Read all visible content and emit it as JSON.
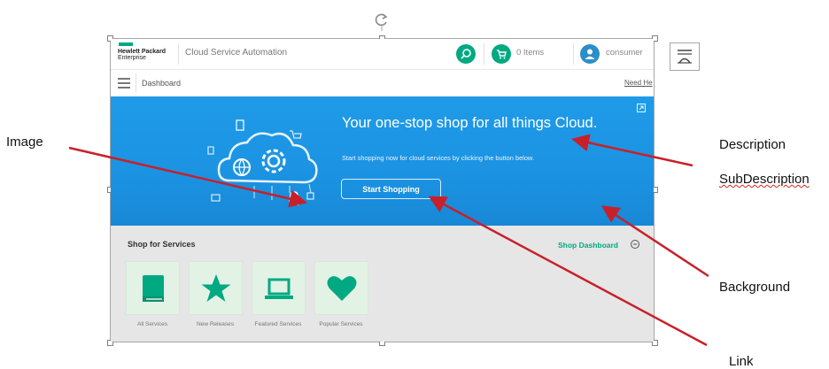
{
  "header": {
    "brand_line1": "Hewlett Packard",
    "brand_line2": "Enterprise",
    "app_title": "Cloud Service Automation",
    "cart_items": "0 Items",
    "user_name": "consumer"
  },
  "subbar": {
    "title": "Dashboard",
    "help_link": "Need He"
  },
  "hero": {
    "title": "Your one-stop shop for all things Cloud.",
    "subtitle": "Start shopping now for cloud services by clicking the button below.",
    "button_label": "Start Shopping"
  },
  "services": {
    "title": "Shop for Services",
    "dashboard_link": "Shop Dashboard",
    "tiles": [
      {
        "label": "All Services",
        "icon": "book-icon"
      },
      {
        "label": "New Releases",
        "icon": "star-icon"
      },
      {
        "label": "Featured Services",
        "icon": "laptop-icon"
      },
      {
        "label": "Popular Services",
        "icon": "heart-icon"
      }
    ]
  },
  "annotations": {
    "image": "Image",
    "description": "Description",
    "subdescription": "SubDescription",
    "background": "Background",
    "link": "Link"
  },
  "colors": {
    "brand_green": "#01a982",
    "hero_blue": "#1b93e2",
    "tile_bg": "#e2f3e6",
    "arrow_red": "#c8202a"
  }
}
